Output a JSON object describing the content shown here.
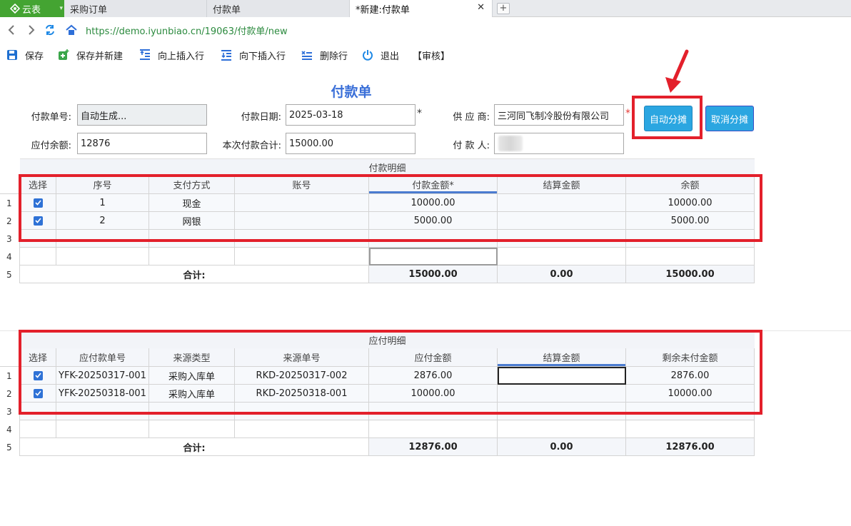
{
  "tabbar": {
    "brand": "云表",
    "tabs": [
      {
        "label": "采购订单",
        "active": false
      },
      {
        "label": "付款单",
        "active": false
      },
      {
        "label": "*新建:付款单",
        "active": true
      }
    ]
  },
  "address": {
    "url": "https://demo.iyunbiao.cn/19063/付款单/new"
  },
  "toolbar": {
    "save": "保存",
    "save_new": "保存并新建",
    "insert_above": "向上插入行",
    "insert_below": "向下插入行",
    "delete_row": "删除行",
    "exit": "退出",
    "audit": "【审核】"
  },
  "form": {
    "title": "付款单",
    "doc_no_label": "付款单号:",
    "doc_no_value": "自动生成...",
    "date_label": "付款日期:",
    "date_value": "2025-03-18",
    "supplier_label": "供 应 商:",
    "supplier_value": "三河同飞制冷股份有限公司",
    "payable_balance_label": "应付余额:",
    "payable_balance_value": "12876",
    "payment_total_label": "本次付款合计:",
    "payment_total_value": "15000.00",
    "payer_label": "付 款 人:",
    "required_mark": "*",
    "auto_allocate": "自动分摊",
    "cancel_allocate": "取消分摊"
  },
  "payment_grid": {
    "caption": "付款明细",
    "columns": [
      "选择",
      "序号",
      "支付方式",
      "账号",
      "付款金额*",
      "结算金额",
      "余额"
    ],
    "rows": [
      {
        "num": "1",
        "checked": true,
        "seq": "1",
        "method": "现金",
        "account": "",
        "amount": "10000.00",
        "settled": "",
        "balance": "10000.00"
      },
      {
        "num": "2",
        "checked": true,
        "seq": "2",
        "method": "网银",
        "account": "",
        "amount": "5000.00",
        "settled": "",
        "balance": "5000.00"
      },
      {
        "num": "3",
        "checked": false,
        "seq": "",
        "method": "",
        "account": "",
        "amount": "",
        "settled": "",
        "balance": ""
      },
      {
        "num": "4",
        "checked": false,
        "seq": "",
        "method": "",
        "account": "",
        "amount": "",
        "settled": "",
        "balance": ""
      }
    ],
    "sum": {
      "num": "5",
      "label": "合计:",
      "amount": "15000.00",
      "settled": "0.00",
      "balance": "15000.00"
    }
  },
  "payable_grid": {
    "caption": "应付明细",
    "columns": [
      "选择",
      "应付款单号",
      "来源类型",
      "来源单号",
      "应付金额",
      "结算金额",
      "剩余未付金额"
    ],
    "rows": [
      {
        "num": "1",
        "checked": true,
        "doc": "YFK-20250317-001",
        "src_type": "采购入库单",
        "src_no": "RKD-20250317-002",
        "payable": "2876.00",
        "settled": "",
        "remaining": "2876.00"
      },
      {
        "num": "2",
        "checked": true,
        "doc": "YFK-20250318-001",
        "src_type": "采购入库单",
        "src_no": "RKD-20250318-001",
        "payable": "10000.00",
        "settled": "",
        "remaining": "10000.00"
      },
      {
        "num": "3",
        "checked": false,
        "doc": "",
        "src_type": "",
        "src_no": "",
        "payable": "",
        "settled": "",
        "remaining": ""
      },
      {
        "num": "4",
        "checked": false,
        "doc": "",
        "src_type": "",
        "src_no": "",
        "payable": "",
        "settled": "",
        "remaining": ""
      }
    ],
    "sum": {
      "num": "5",
      "label": "合计:",
      "payable": "12876.00",
      "settled": "0.00",
      "remaining": "12876.00"
    }
  },
  "colors": {
    "brand": "#44a432",
    "accent": "#3a6fd8",
    "button": "#2ba6e1",
    "highlight": "#e3202b"
  }
}
